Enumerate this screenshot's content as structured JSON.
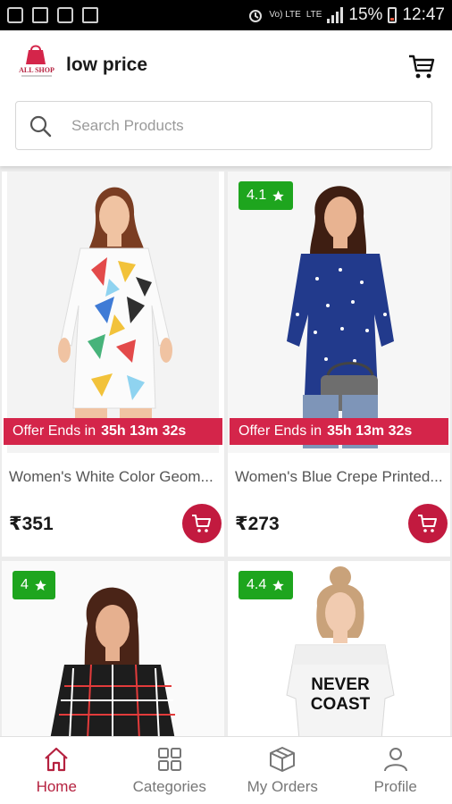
{
  "status_bar": {
    "network_label": "Vo) LTE",
    "network_sub": "LTE",
    "battery": "15%",
    "time": "12:47"
  },
  "header": {
    "logo_text": "ALL SHOP",
    "title": "low price",
    "cart_icon": "cart-icon"
  },
  "search": {
    "placeholder": "Search Products",
    "value": ""
  },
  "colors": {
    "accent": "#c21a3f",
    "offer_banner": "#d4254a",
    "rating_badge": "#1ea51e",
    "nav_active": "#b5213f"
  },
  "products": [
    {
      "rating": "",
      "offer_label": "Offer Ends in",
      "offer_timer": "35h 13m 32s",
      "name": "Women's White Color Geom...",
      "price": "₹351"
    },
    {
      "rating": "4.1",
      "offer_label": "Offer Ends in",
      "offer_timer": "35h 13m 32s",
      "name": "Women's Blue Crepe Printed...",
      "price": "₹273"
    },
    {
      "rating": "4"
    },
    {
      "rating": "4.4",
      "shirt_text_1": "NEVER",
      "shirt_text_2": "COAST"
    }
  ],
  "nav": [
    {
      "label": "Home",
      "icon": "home-icon"
    },
    {
      "label": "Categories",
      "icon": "grid-icon"
    },
    {
      "label": "My Orders",
      "icon": "box-icon"
    },
    {
      "label": "Profile",
      "icon": "person-icon"
    }
  ]
}
